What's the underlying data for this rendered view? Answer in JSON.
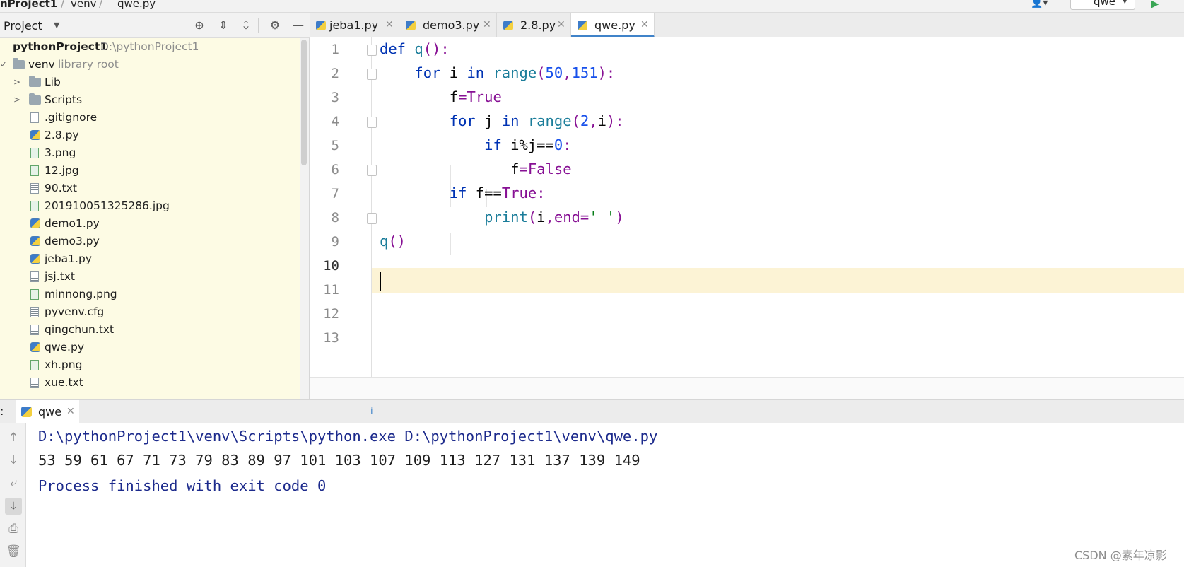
{
  "nav_bar": {
    "crumbs": [
      "nProject1",
      "venv",
      "qwe.py"
    ],
    "run_config": "qwe"
  },
  "project_panel": {
    "title": "Project",
    "tools": [
      "target-icon",
      "expand-all-icon",
      "collapse-all-icon",
      "gear-icon",
      "minimize-icon"
    ],
    "root": {
      "label": "pythonProject1",
      "hint": "D:\\pythonProject1"
    },
    "venv": {
      "label": "venv",
      "hint": "library root"
    },
    "folders": [
      "Lib",
      "Scripts"
    ],
    "files": [
      {
        "name": ".gitignore",
        "kind": "git"
      },
      {
        "name": "2.8.py",
        "kind": "py"
      },
      {
        "name": "3.png",
        "kind": "img"
      },
      {
        "name": "12.jpg",
        "kind": "img"
      },
      {
        "name": "90.txt",
        "kind": "txt"
      },
      {
        "name": "201910051325286.jpg",
        "kind": "img"
      },
      {
        "name": "demo1.py",
        "kind": "py"
      },
      {
        "name": "demo3.py",
        "kind": "py"
      },
      {
        "name": "jeba1.py",
        "kind": "py"
      },
      {
        "name": "jsj.txt",
        "kind": "txt"
      },
      {
        "name": "minnong.png",
        "kind": "img"
      },
      {
        "name": "pyvenv.cfg",
        "kind": "txt"
      },
      {
        "name": "qingchun.txt",
        "kind": "txt"
      },
      {
        "name": "qwe.py",
        "kind": "py"
      },
      {
        "name": "xh.png",
        "kind": "img"
      },
      {
        "name": "xue.txt",
        "kind": "txt"
      }
    ]
  },
  "editor": {
    "tabs": [
      {
        "label": "jeba1.py",
        "active": false
      },
      {
        "label": "demo3.py",
        "active": false
      },
      {
        "label": "2.8.py",
        "active": false
      },
      {
        "label": "qwe.py",
        "active": true
      }
    ],
    "line_numbers": [
      "1",
      "2",
      "3",
      "4",
      "5",
      "6",
      "7",
      "8",
      "9",
      "10",
      "11",
      "12",
      "13"
    ],
    "current_line": "10",
    "code": {
      "l1_kw": "def ",
      "l1_fn": "q",
      "l1_rest": "():",
      "l2_kw": "for ",
      "l2_var": "i ",
      "l2_in": "in ",
      "l2_fn": "range",
      "l2_p1": "(",
      "l2_n1": "50",
      "l2_c": ",",
      "l2_n2": "151",
      "l2_p2": "):",
      "l3_var": "f",
      "l3_eq": "=",
      "l3_val": "True",
      "l4_kw": "for ",
      "l4_var": "j ",
      "l4_in": "in ",
      "l4_fn": "range",
      "l4_p1": "(",
      "l4_n1": "2",
      "l4_c": ",",
      "l4_var2": "i",
      "l4_p2": "):",
      "l5_kw": "if ",
      "l5_expr": "i%j==",
      "l5_n": "0",
      "l5_colon": ":",
      "l6_var": "f",
      "l6_eq": "=",
      "l6_val": "False",
      "l7_kw": "if ",
      "l7_expr": "f==",
      "l7_val": "True",
      "l7_colon": ":",
      "l8_fn": "print",
      "l8_p1": "(",
      "l8_var": "i",
      "l8_c": ",",
      "l8_kw": "end",
      "l8_eq": "=",
      "l8_str": "' '",
      "l8_p2": ")",
      "l9_fn": "q",
      "l9_p": "()"
    }
  },
  "run_window": {
    "colon": ":",
    "tab_label": "qwe",
    "marker": "i",
    "tools": [
      "up-arrow-icon",
      "down-arrow-icon",
      "soft-wrap-icon",
      "scroll-to-end-icon",
      "print-icon",
      "trash-icon"
    ],
    "command": "D:\\pythonProject1\\venv\\Scripts\\python.exe D:\\pythonProject1\\venv\\qwe.py",
    "output": "53 59 61 67 71 73 79 83 89 97 101 103 107 109 113 127 131 137 139 149",
    "exit": "Process finished with exit code 0"
  },
  "watermark": "CSDN @素年凉影"
}
